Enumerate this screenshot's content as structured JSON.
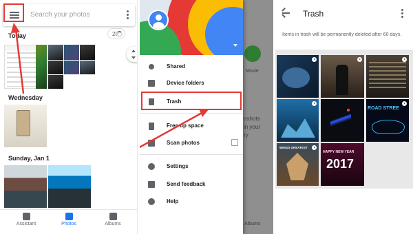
{
  "panel1": {
    "search_placeholder": "Search your photos",
    "sections": [
      {
        "label": "Today"
      },
      {
        "label": "Wednesday"
      },
      {
        "label": "Sunday, Jan 1"
      }
    ],
    "count_badge": "20",
    "bottom_nav": [
      {
        "label": "Assistant",
        "icon": "assistant-icon",
        "active": false
      },
      {
        "label": "Photos",
        "icon": "photos-icon",
        "active": true
      },
      {
        "label": "Albums",
        "icon": "albums-icon",
        "active": false
      }
    ]
  },
  "panel2": {
    "menu": [
      {
        "label": "Shared",
        "icon": "people-icon"
      },
      {
        "label": "Device folders",
        "icon": "folder-icon"
      },
      {
        "label": "Trash",
        "icon": "trash-icon"
      },
      {
        "label": "Free up space",
        "icon": "phone-clean-icon"
      },
      {
        "label": "Scan photos",
        "icon": "photoscan-icon"
      },
      {
        "label": "Settings",
        "icon": "gear-icon"
      },
      {
        "label": "Send feedback",
        "icon": "feedback-icon"
      },
      {
        "label": "Help",
        "icon": "help-icon"
      }
    ],
    "behind": {
      "movie_label": "Movie",
      "fragment_1": "nshots",
      "fragment_2": "in your",
      "fragment_3": "ry",
      "albums_label": "Albums"
    }
  },
  "panel3": {
    "title": "Trash",
    "info": "Items in trash will be permanently deleted after 60 days.",
    "tile_texts": {
      "tile_6": "ROAD STREE",
      "tile_7": "WINGS GREATEST",
      "tile_8_line1": "HAPPY NEW YEAR",
      "tile_8_line2": "2017"
    }
  },
  "colors": {
    "highlight_red": "#e53935",
    "accent_blue": "#1a73e8",
    "drawer_dim": "#9e9e9e"
  }
}
